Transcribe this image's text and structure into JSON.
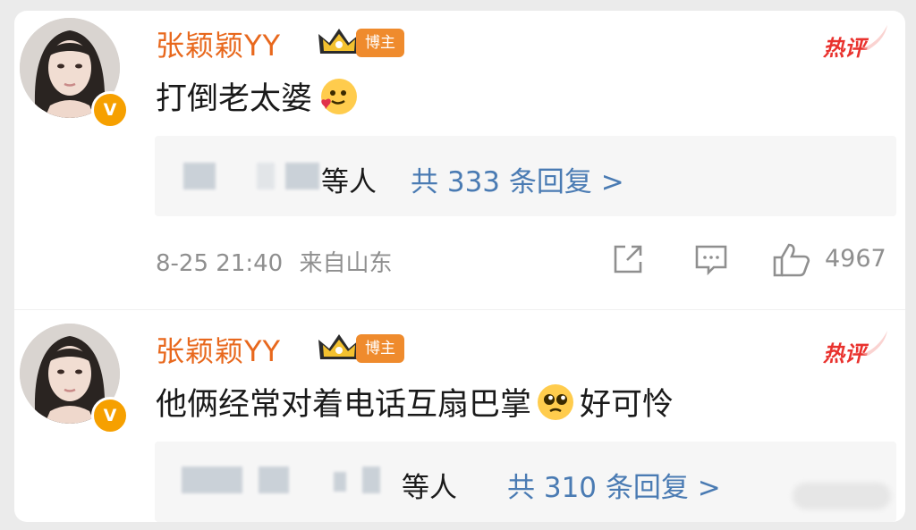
{
  "comments": [
    {
      "username": "张颖颖YY",
      "role_badge": "博主",
      "hot_label": "热评",
      "text": "打倒老太婆",
      "emoji": "smile-love-emoji",
      "reply_suffix": "等人",
      "reply_link": "共 333 条回复 >",
      "time": "8-25 21:40",
      "location": "来自山东",
      "likes": "4967"
    },
    {
      "username": "张颖颖YY",
      "role_badge": "博主",
      "hot_label": "热评",
      "text_before": "他俩经常对着电话互扇巴掌",
      "emoji": "pleading-face-emoji",
      "text_after": "好可怜",
      "reply_suffix": "等人",
      "reply_link": "共 310 条回复 >"
    }
  ],
  "colors": {
    "username": "#e8681d",
    "badge": "#ef8b2d",
    "hot": "#e9322e",
    "link": "#4a7bb3",
    "meta": "#8f8f8f"
  },
  "icons": [
    "verified-v-icon",
    "crown-icon",
    "share-icon",
    "comment-icon",
    "like-icon"
  ]
}
